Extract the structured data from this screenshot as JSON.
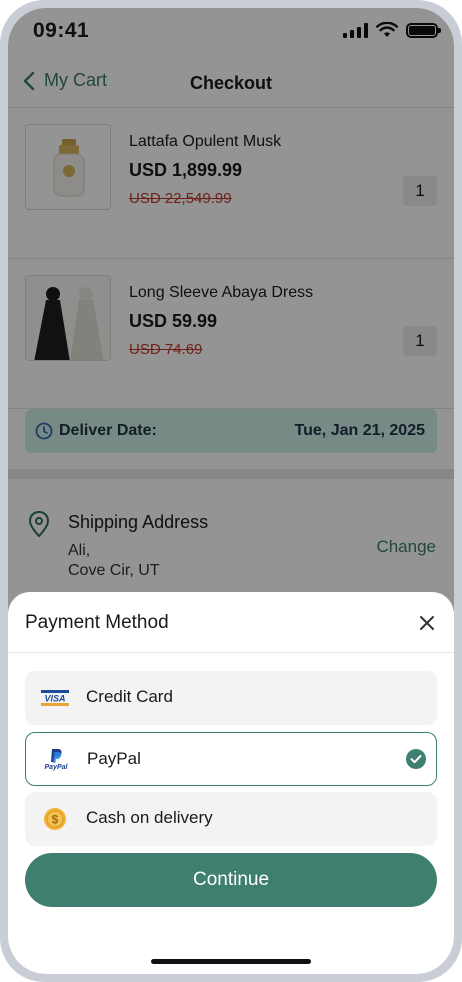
{
  "status_bar": {
    "time": "09:41"
  },
  "header": {
    "back_label": "My Cart",
    "title": "Checkout"
  },
  "cart": {
    "items": [
      {
        "name": "Lattafa Opulent Musk",
        "price": "USD 1,899.99",
        "old_price": "USD 22,549.99",
        "quantity": "1"
      },
      {
        "name": "Long Sleeve Abaya Dress",
        "price": "USD 59.99",
        "old_price": "USD 74.69",
        "quantity": "1"
      }
    ]
  },
  "delivery": {
    "label": "Deliver Date:",
    "date": "Tue, Jan 21, 2025"
  },
  "shipping": {
    "title": "Shipping Address",
    "line1": "Ali,",
    "line2": "Cove Cir, UT",
    "change_label": "Change"
  },
  "payment_sheet": {
    "title": "Payment Method",
    "options": [
      {
        "label": "Credit Card",
        "icon": "visa-icon",
        "selected": false
      },
      {
        "label": "PayPal",
        "icon": "paypal-icon",
        "selected": true
      },
      {
        "label": "Cash on delivery",
        "icon": "coin-icon",
        "selected": false
      }
    ],
    "visa_text": "VISA",
    "paypal_text": "PayPal",
    "coin_symbol": "$",
    "continue_label": "Continue"
  },
  "colors": {
    "accent": "#3f7f6f",
    "delivery_bg": "#cfeee5",
    "strike": "#c0392b"
  }
}
